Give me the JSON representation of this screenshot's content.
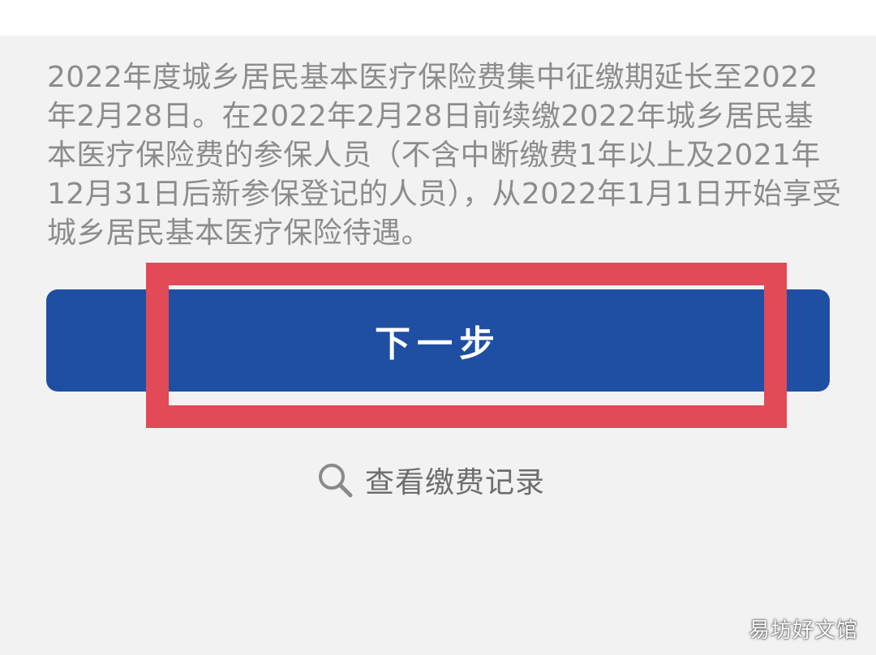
{
  "notice": {
    "text": "2022年度城乡居民基本医疗保险费集中征缴期延长至2022年2月28日。在2022年2月28日前续缴2022年城乡居民基本医疗保险费的参保人员（不含中断缴费1年以上及2021年12月31日后新参保登记的人员），从2022年1月1日开始享受城乡居民基本医疗保险待遇。"
  },
  "next_button": {
    "label": "下一步"
  },
  "records_link": {
    "label": "查看缴费记录",
    "icon": "search-icon"
  },
  "watermark": {
    "text": "易坊好文馆"
  },
  "colors": {
    "background": "#f2f2f2",
    "primary_button": "#1f4fa3",
    "highlight": "#e24a57",
    "notice_text": "#8c8c8c",
    "link_text": "#6d6d6d"
  }
}
